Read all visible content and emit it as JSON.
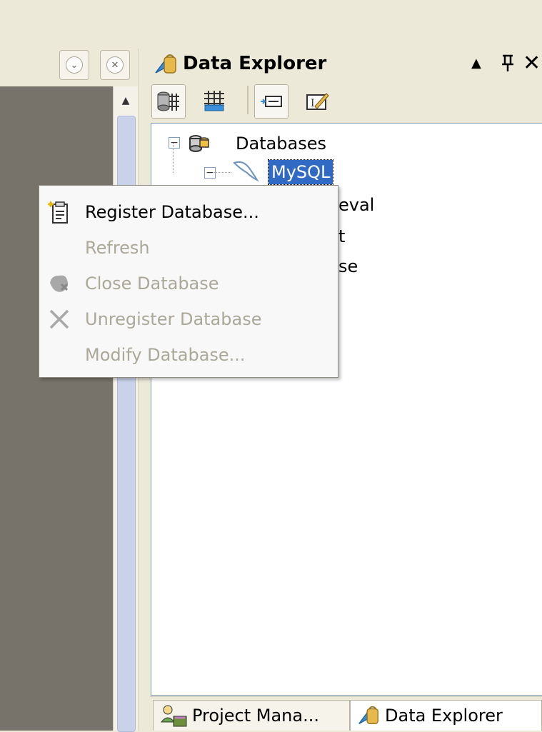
{
  "left_panel": {
    "buttons": [
      {
        "name": "minimize-panel-button",
        "glyph": "⌄"
      },
      {
        "name": "close-panel-button",
        "glyph": "✕"
      }
    ]
  },
  "data_explorer": {
    "title": "Data Explorer",
    "title_controls": {
      "menu": "▲",
      "pin": "ᵽ",
      "close": "✕"
    },
    "toolbar": [
      {
        "name": "new-data-source-button",
        "icon": "database-grid-icon"
      },
      {
        "name": "new-data-set-button",
        "icon": "grid-table-icon"
      },
      {
        "name": "properties-button",
        "icon": "field-icon"
      },
      {
        "name": "edit-button",
        "icon": "edit-icon"
      }
    ],
    "tree": {
      "root_label": "Databases",
      "selected_label": "MySQL",
      "partial_labels": [
        "eval",
        "t",
        "se"
      ]
    }
  },
  "bottom_tabs": [
    {
      "label": "Project Mana...",
      "icon": "project-icon",
      "active": false
    },
    {
      "label": "Data Explorer",
      "icon": "data-explorer-icon",
      "active": true
    }
  ],
  "context_menu": {
    "items": [
      {
        "label": "Register Database...",
        "enabled": true,
        "icon": "register-database-icon"
      },
      {
        "label": "Refresh",
        "enabled": false,
        "icon": ""
      },
      {
        "label": "Close Database",
        "enabled": false,
        "icon": "close-database-icon"
      },
      {
        "label": "Unregister Database",
        "enabled": false,
        "icon": "unregister-x-icon"
      },
      {
        "label": "Modify Database...",
        "enabled": false,
        "icon": ""
      }
    ]
  },
  "colors": {
    "selection": "#316ac5",
    "disabled_text": "#aca899",
    "left_panel_bg": "#77736a"
  }
}
